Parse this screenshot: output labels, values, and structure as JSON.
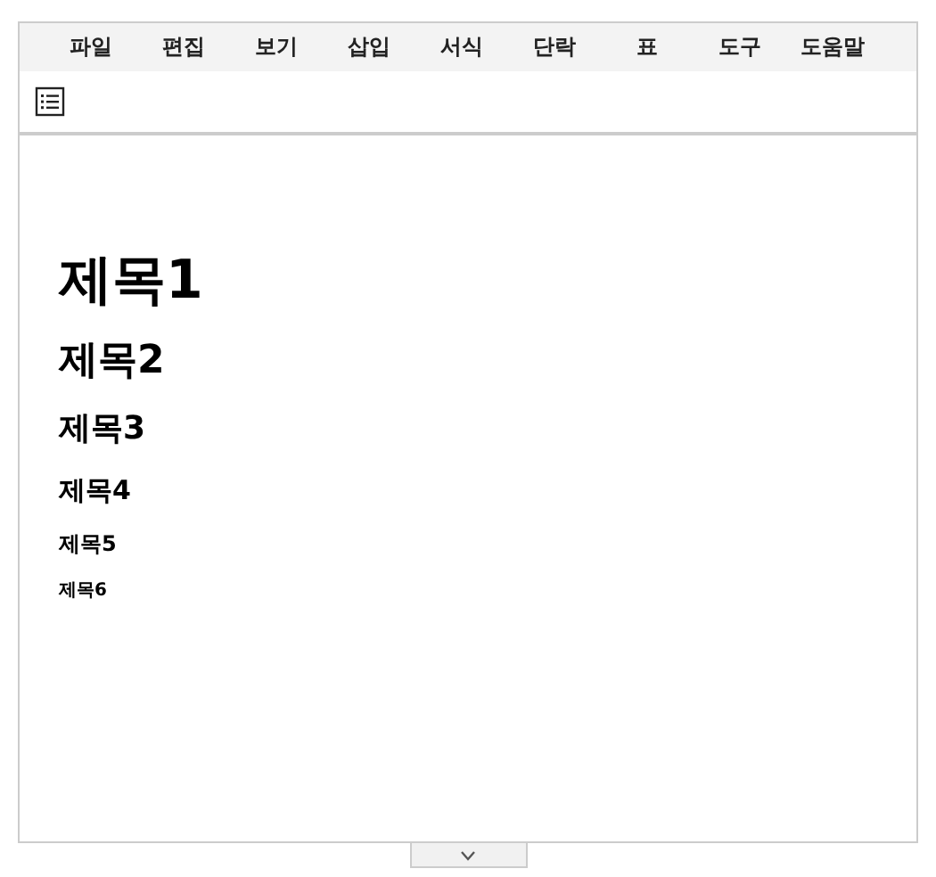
{
  "menu": [
    "파일",
    "편집",
    "보기",
    "삽입",
    "서식",
    "단락",
    "표",
    "도구",
    "도움말"
  ],
  "headings": [
    {
      "kind": "h1",
      "text": "제목1"
    },
    {
      "kind": "h2",
      "text": "제목2"
    },
    {
      "kind": "h3",
      "text": "제목3"
    },
    {
      "kind": "h4",
      "text": "제목4"
    },
    {
      "kind": "h5",
      "text": "제목5"
    },
    {
      "kind": "h6",
      "text": "제목6"
    }
  ]
}
